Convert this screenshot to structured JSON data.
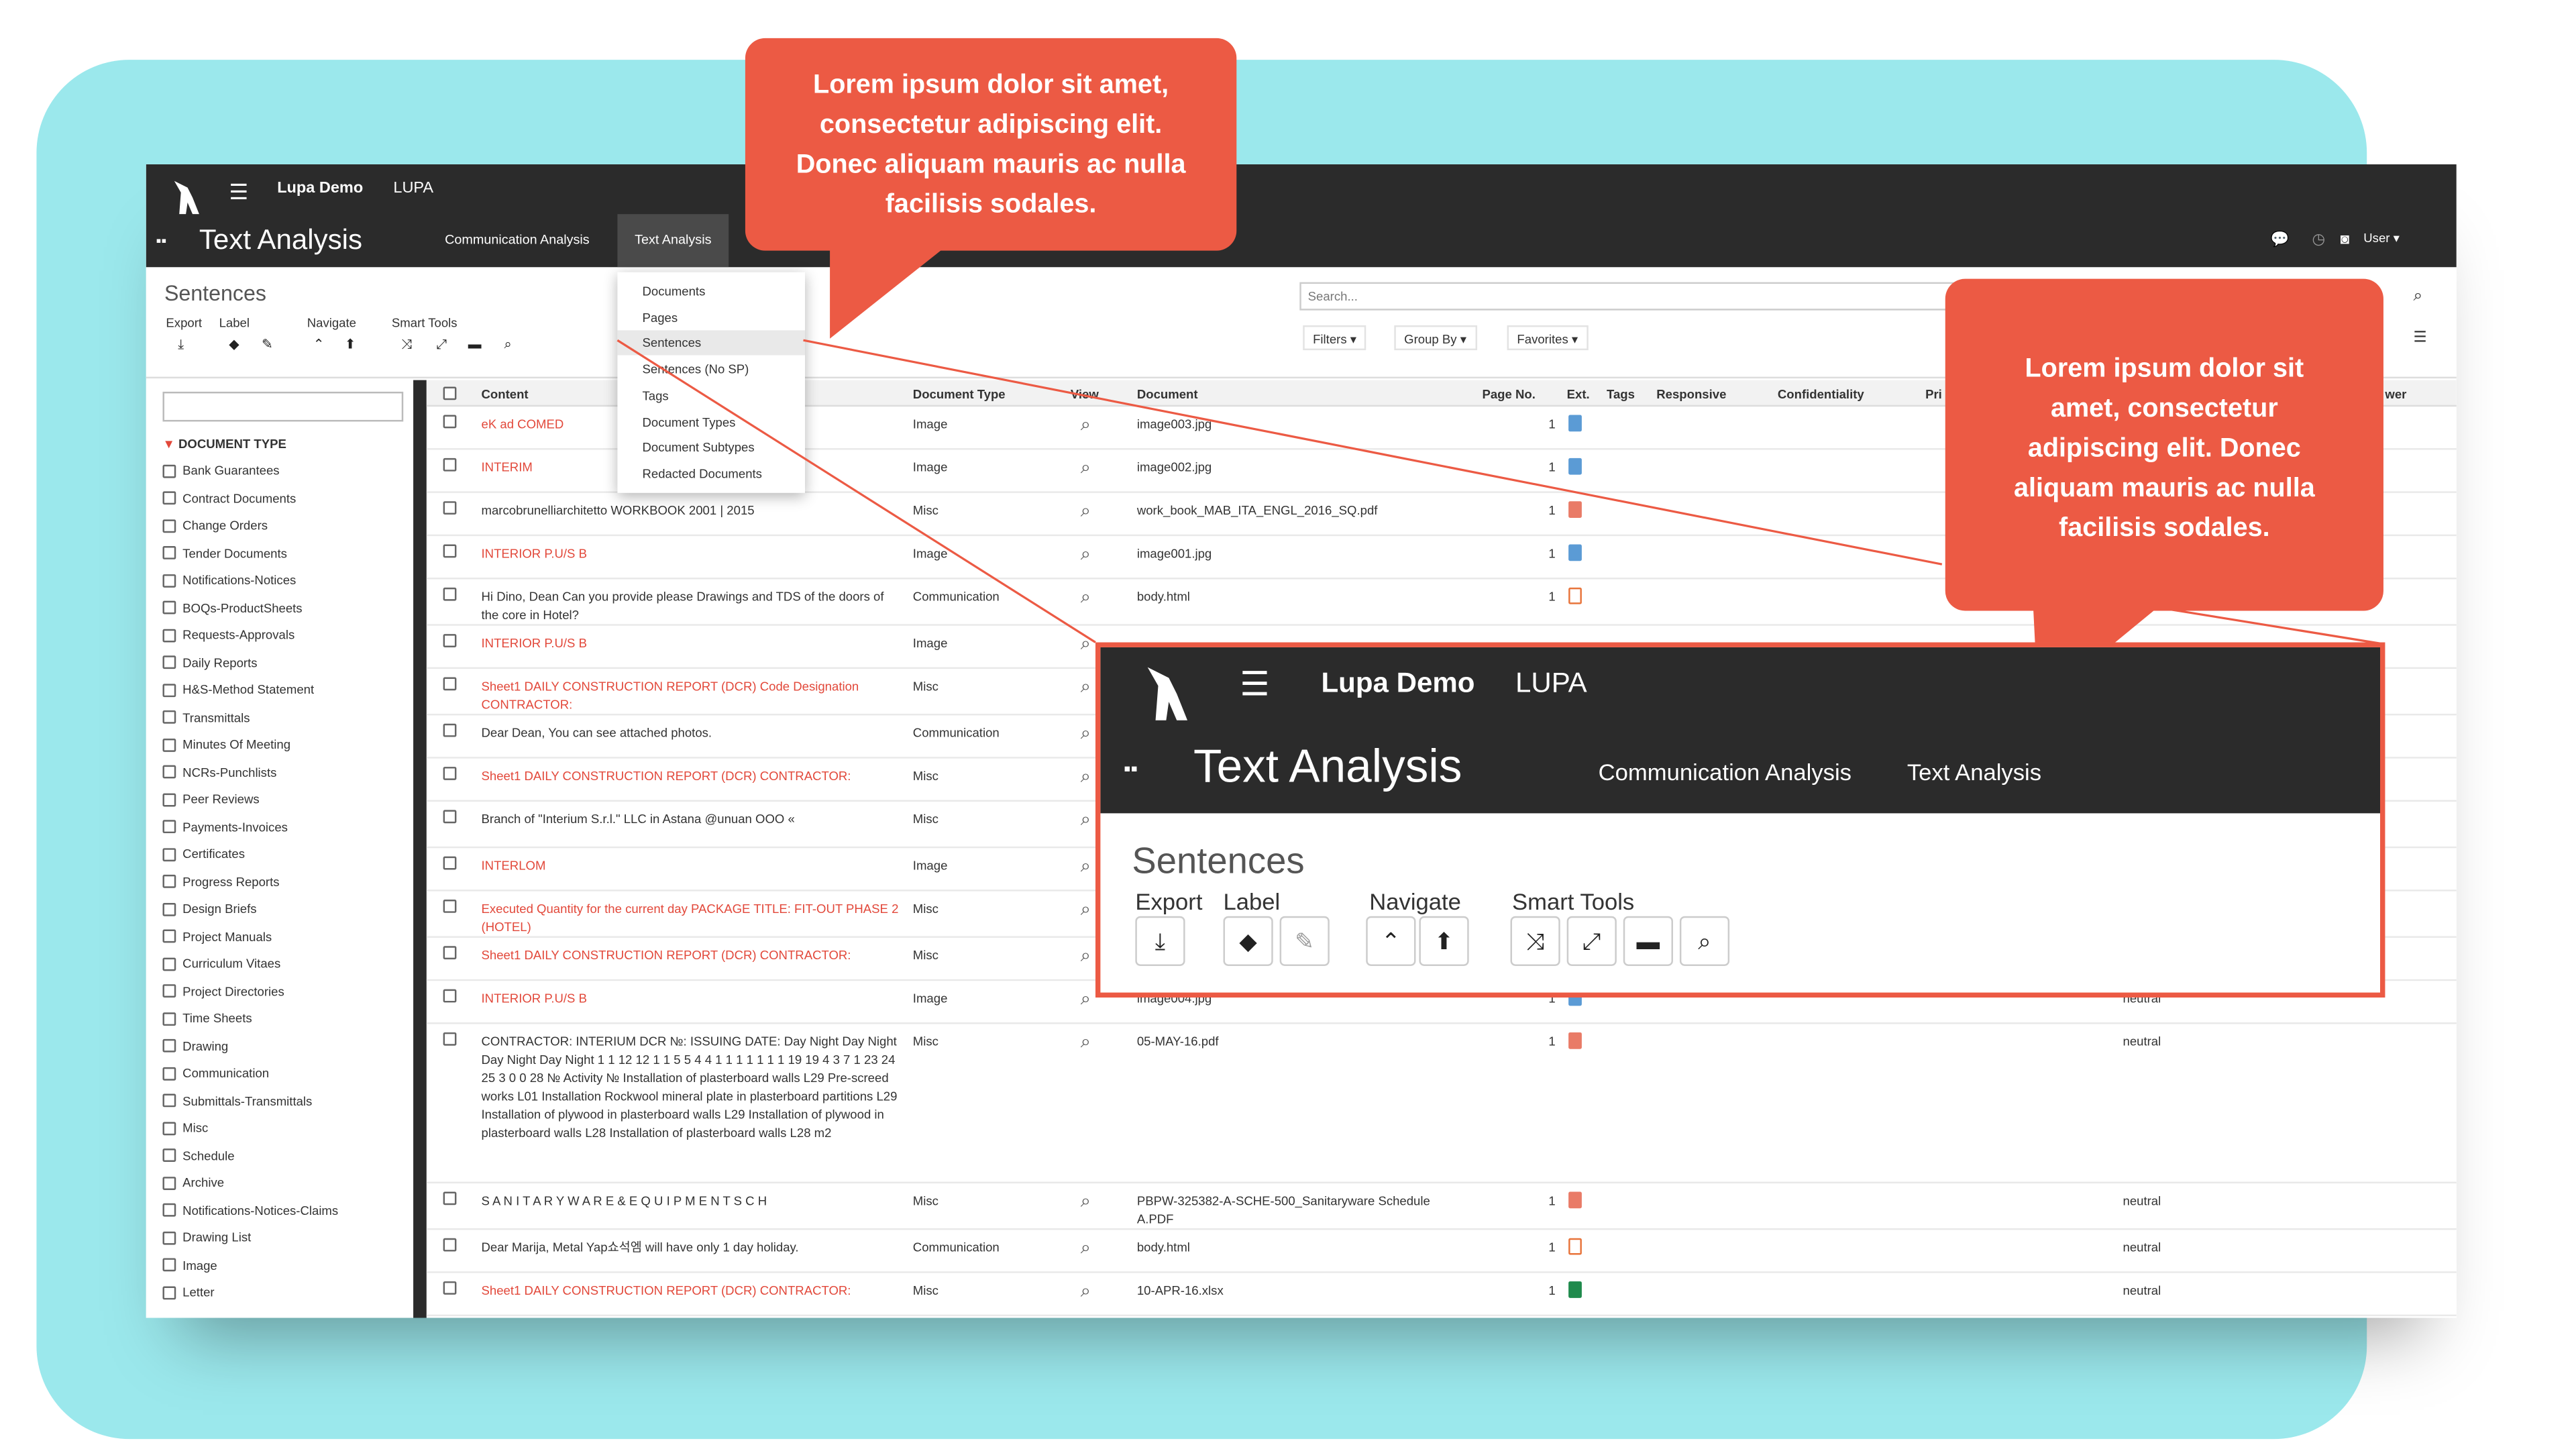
{
  "callouts": {
    "top": "Lorem ipsum dolor sit amet, consectetur adipiscing elit. Donec aliquam mauris ac nulla facilisis sodales.",
    "right": "Lorem ipsum dolor sit amet, consectetur adipiscing elit. Donec aliquam mauris ac nulla facilisis sodales."
  },
  "app": {
    "brand": "Lupa Demo",
    "brand2": "LUPA",
    "page_title": "Text Analysis",
    "nav": [
      "Communication Analysis",
      "Text Analysis"
    ],
    "user": "User ▾"
  },
  "control_panel": {
    "breadcrumb": "Sentences",
    "groups": [
      "Export",
      "Label",
      "Navigate",
      "Smart Tools"
    ],
    "search_placeholder": "Search...",
    "filters": "Filters ▾",
    "group_by": "Group By ▾",
    "favorites": "Favorites ▾"
  },
  "dropdown": [
    "Documents",
    "Pages",
    "Sentences",
    "Sentences (No SP)",
    "Tags",
    "Document Types",
    "Document Subtypes",
    "Redacted Documents"
  ],
  "sidebar": {
    "heading": "DOCUMENT TYPE",
    "items": [
      "Bank Guarantees",
      "Contract Documents",
      "Change Orders",
      "Tender Documents",
      "Notifications-Notices",
      "BOQs-ProductSheets",
      "Requests-Approvals",
      "Daily Reports",
      "H&S-Method Statement",
      "Transmittals",
      "Minutes Of Meeting",
      "NCRs-Punchlists",
      "Peer Reviews",
      "Payments-Invoices",
      "Certificates",
      "Progress Reports",
      "Design Briefs",
      "Project Manuals",
      "Curriculum Vitaes",
      "Project Directories",
      "Time Sheets",
      "Drawing",
      "Communication",
      "Submittals-Transmittals",
      "Misc",
      "Schedule",
      "Archive",
      "Notifications-Notices-Claims",
      "Drawing List",
      "Image",
      "Letter"
    ]
  },
  "table": {
    "headers": [
      "Content",
      "Document Type",
      "View",
      "Document",
      "Page No.",
      "Ext.",
      "Tags",
      "Responsive",
      "Confidentiality",
      "Pri",
      "wer"
    ],
    "rows": [
      {
        "content": "eK ad COMED",
        "red": true,
        "type": "Image",
        "doc": "image003.jpg",
        "page": "1",
        "ext": "png",
        "sentiment": ""
      },
      {
        "content": "INTERIM",
        "red": true,
        "type": "Image",
        "doc": "image002.jpg",
        "page": "1",
        "ext": "png",
        "sentiment": ""
      },
      {
        "content": "marcobrunelliarchitetto WORKBOOK 2001 | 2015",
        "red": false,
        "type": "Misc",
        "doc": "work_book_MAB_ITA_ENGL_2016_SQ.pdf",
        "page": "1",
        "ext": "pdf",
        "sentiment": ""
      },
      {
        "content": "INTERIOR P.U/S B",
        "red": true,
        "type": "Image",
        "doc": "image001.jpg",
        "page": "1",
        "ext": "png",
        "sentiment": ""
      },
      {
        "content": "Hi Dino, Dean Can you provide please Drawings and TDS of the doors of the core in Hotel?",
        "red": false,
        "type": "Communication",
        "doc": "body.html",
        "page": "1",
        "ext": "html",
        "sentiment": ""
      },
      {
        "content": "INTERIOR P.U/S B",
        "red": true,
        "type": "Image",
        "doc": "",
        "page": "",
        "ext": "",
        "sentiment": ""
      },
      {
        "content": "Sheet1 DAILY CONSTRUCTION REPORT (DCR) Code Designation CONTRACTOR:",
        "red": true,
        "type": "Misc",
        "doc": "",
        "page": "",
        "ext": "",
        "sentiment": ""
      },
      {
        "content": "Dear Dean, You can see attached photos.",
        "red": false,
        "type": "Communication",
        "doc": "",
        "page": "",
        "ext": "",
        "sentiment": ""
      },
      {
        "content": "Sheet1 DAILY CONSTRUCTION REPORT (DCR) CONTRACTOR:",
        "red": true,
        "type": "Misc",
        "doc": "",
        "page": "",
        "ext": "",
        "sentiment": ""
      },
      {
        "content": "Branch of \"Interium S.r.l.\" LLC in Astana @unuan OOO «",
        "red": false,
        "type": "Misc",
        "doc": "",
        "page": "",
        "ext": "",
        "sentiment": ""
      },
      {
        "content": "INTERLOM",
        "red": true,
        "type": "Image",
        "doc": "",
        "page": "",
        "ext": "",
        "sentiment": ""
      },
      {
        "content": "Executed Quantity for the current day PACKAGE TITLE: FIT-OUT PHASE 2 (HOTEL)",
        "red": true,
        "type": "Misc",
        "doc": "",
        "page": "",
        "ext": "",
        "sentiment": ""
      },
      {
        "content": "Sheet1 DAILY CONSTRUCTION REPORT (DCR) CONTRACTOR:",
        "red": true,
        "type": "Misc",
        "doc": "",
        "page": "",
        "ext": "",
        "sentiment": ""
      },
      {
        "content": "INTERIOR P.U/S B",
        "red": true,
        "type": "Image",
        "doc": "image004.jpg",
        "page": "1",
        "ext": "png",
        "sentiment": "neutral"
      },
      {
        "content": "CONTRACTOR: INTERIUM DCR №: ISSUING DATE: Day Night Day Night Day Night Day Night 1 1 12 12 1 1 5 5 4 4 1 1 1 1 1 1 1 19 19 4 3 7 1 23 24 25 3 0 0 28 № Activity № Installation of plasterboard walls L29 Pre-screed works L01 Installation Rockwool mineral plate in plasterboard partitions L29 Installation of plywood in plasterboard walls L29 Installation of plywood in plasterboard walls L28 Installation of plasterboard walls L28 m2",
        "red": false,
        "type": "Misc",
        "doc": "05-MAY-16.pdf",
        "page": "1",
        "ext": "pdf",
        "sentiment": "neutral"
      },
      {
        "content": "S A N I T A R Y W A R E & E Q U I P M E N T S C H",
        "red": false,
        "type": "Misc",
        "doc": "PBPW-325382-A-SCHE-500_Sanitaryware Schedule A.PDF",
        "page": "1",
        "ext": "pdf",
        "sentiment": "neutral"
      },
      {
        "content": "Dear Marija, Metal Yap쇼석엠 will have only 1 day holiday.",
        "red": false,
        "type": "Communication",
        "doc": "body.html",
        "page": "1",
        "ext": "html",
        "sentiment": "neutral"
      },
      {
        "content": "Sheet1 DAILY CONSTRUCTION REPORT (DCR) CONTRACTOR:",
        "red": true,
        "type": "Misc",
        "doc": "10-APR-16.xlsx",
        "page": "1",
        "ext": "xls",
        "sentiment": "neutral"
      }
    ]
  },
  "zoom": {
    "brand": "Lupa Demo",
    "brand2": "LUPA",
    "page_title": "Text Analysis",
    "nav": [
      "Communication Analysis",
      "Text Analysis"
    ],
    "breadcrumb": "Sentences",
    "groups": [
      "Export",
      "Label",
      "Navigate",
      "Smart Tools"
    ]
  },
  "colors": {
    "accent": "#ec5a44",
    "topbar": "#2b2b2b",
    "teal": "#9be8ec"
  }
}
